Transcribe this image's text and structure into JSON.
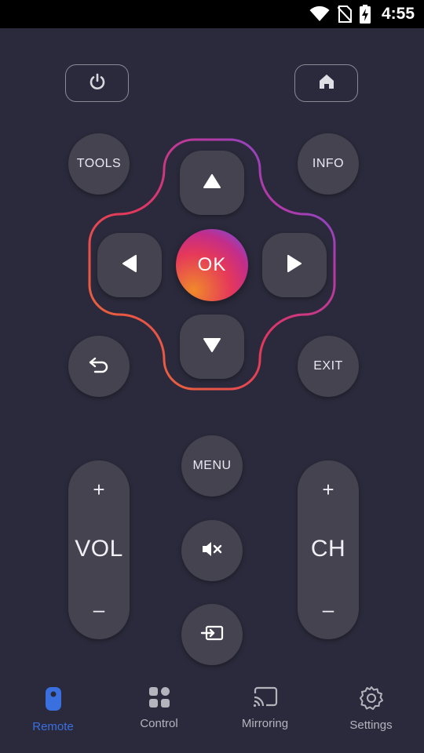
{
  "status": {
    "time": "4:55"
  },
  "remote": {
    "tools_label": "TOOLS",
    "info_label": "INFO",
    "ok_label": "OK",
    "exit_label": "EXIT",
    "menu_label": "MENU",
    "vol": {
      "label": "VOL",
      "plus": "+",
      "minus": "–"
    },
    "ch": {
      "label": "CH",
      "plus": "+",
      "minus": "–"
    }
  },
  "nav": {
    "items": [
      {
        "label": "Remote",
        "icon": "remote-icon",
        "active": true
      },
      {
        "label": "Control",
        "icon": "grid-icon",
        "active": false
      },
      {
        "label": "Mirroring",
        "icon": "cast-icon",
        "active": false
      },
      {
        "label": "Settings",
        "icon": "gear-icon",
        "active": false
      }
    ]
  },
  "colors": {
    "background": "#2b2a3c",
    "button": "#45434f",
    "accent": "#3a6fe0",
    "ok_gradient": [
      "#f08a2a",
      "#e5385a",
      "#c32d8a",
      "#5b5ef0"
    ]
  }
}
